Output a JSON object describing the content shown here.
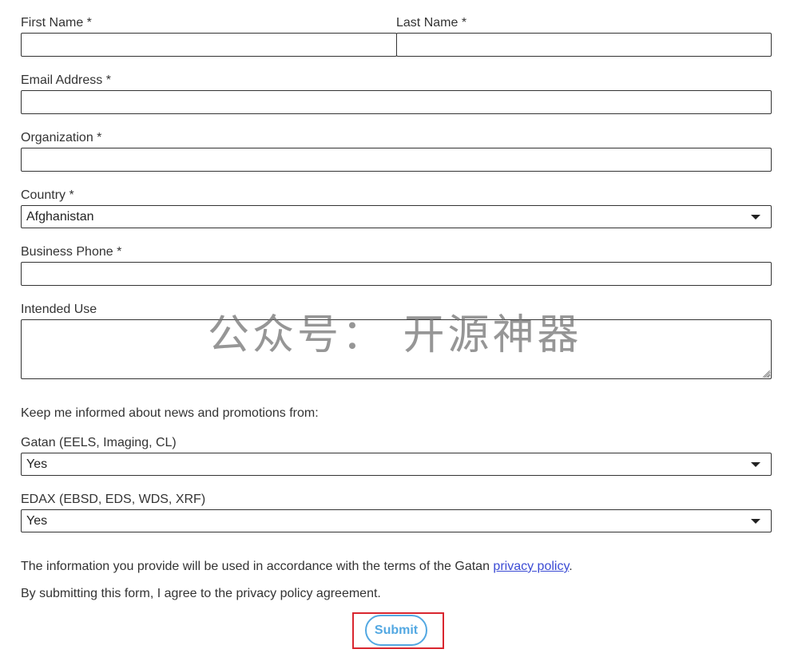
{
  "form": {
    "first_name": {
      "label": "First Name *",
      "value": ""
    },
    "last_name": {
      "label": "Last Name *",
      "value": ""
    },
    "email": {
      "label": "Email Address *",
      "value": ""
    },
    "organization": {
      "label": "Organization *",
      "value": ""
    },
    "country": {
      "label": "Country *",
      "selected": "Afghanistan"
    },
    "business_phone": {
      "label": "Business Phone *",
      "value": ""
    },
    "intended_use": {
      "label": "Intended Use",
      "value": ""
    },
    "subscribe_heading": "Keep me informed about news and promotions from:",
    "gatan": {
      "label": "Gatan (EELS, Imaging, CL)",
      "selected": "Yes"
    },
    "edax": {
      "label": "EDAX (EBSD, EDS, WDS, XRF)",
      "selected": "Yes"
    },
    "privacy_text": "The information you provide will be used in accordance with the terms of the Gatan ",
    "privacy_link": "privacy policy",
    "privacy_period": ".",
    "agreement_text": "By submitting this form, I agree to the privacy policy agreement.",
    "submit_label": "Submit"
  },
  "watermark": "公众号：  开源神器",
  "colors": {
    "text": "#333333",
    "link": "#3b4bd4",
    "submit_accent": "#53a8e2",
    "highlight_border": "#d9262f"
  },
  "icons": {
    "select_caret": "chevron-down-icon",
    "resize_grip": "resize-handle-icon"
  }
}
